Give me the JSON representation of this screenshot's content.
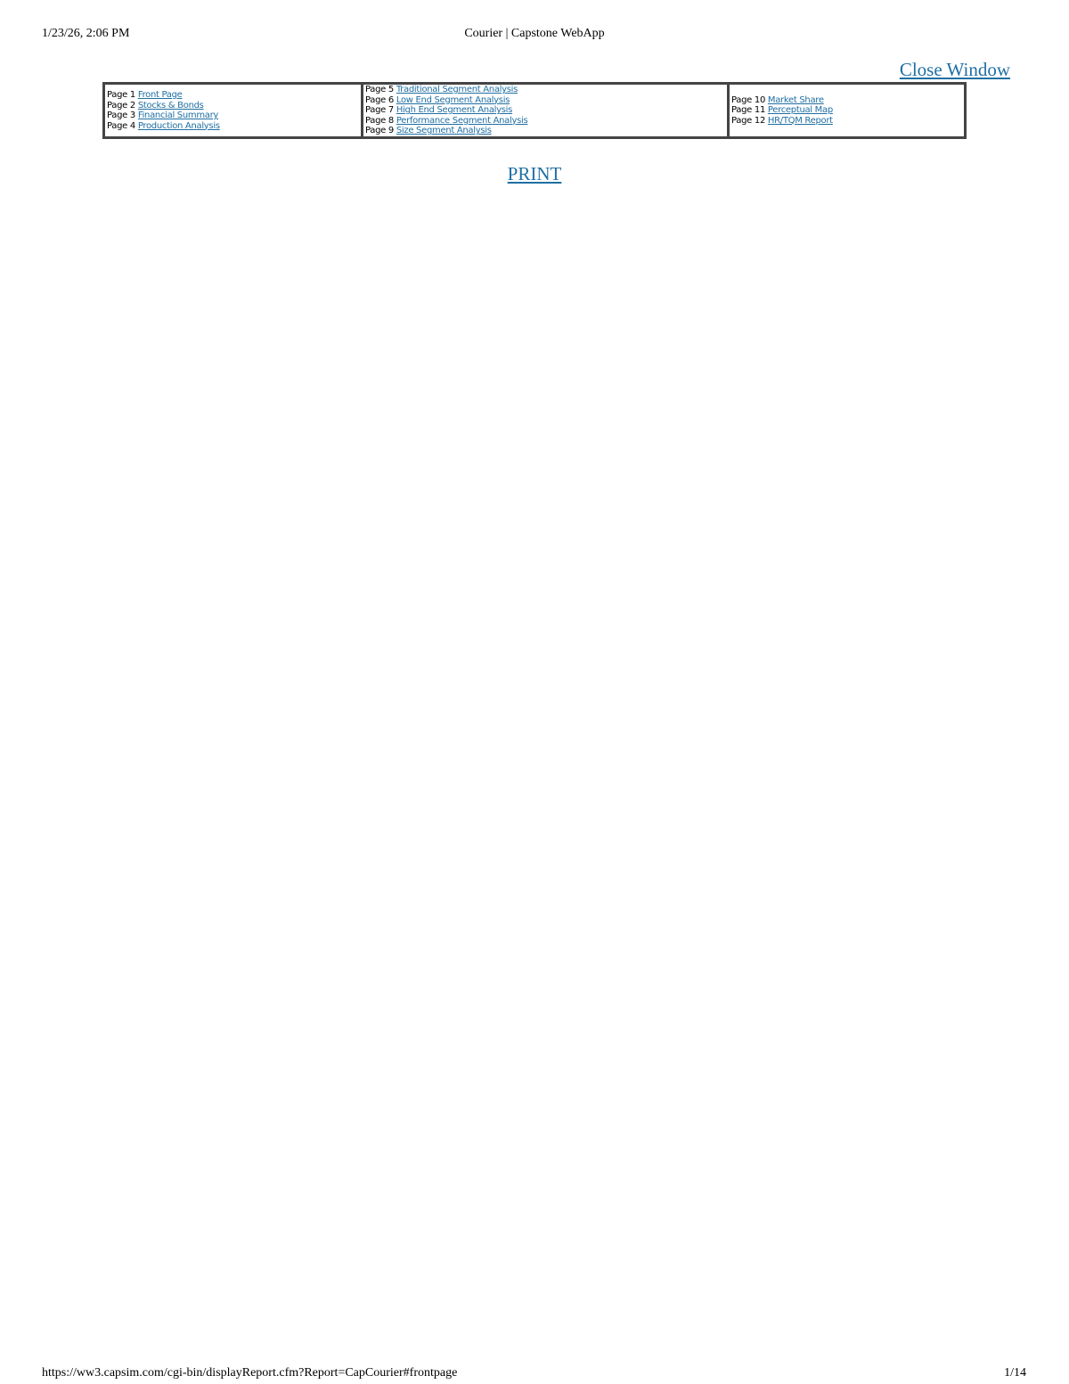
{
  "print_header": {
    "date": "1/23/26, 2:06 PM",
    "title": "Courier | Capstone WebApp"
  },
  "close_window_label": "Close Window",
  "nav": {
    "columns": [
      [
        {
          "page": "Page 1",
          "label": "Front Page"
        },
        {
          "page": "Page 2",
          "label": "Stocks & Bonds"
        },
        {
          "page": "Page 3",
          "label": "Financial Summary"
        },
        {
          "page": "Page 4",
          "label": "Production Analysis"
        }
      ],
      [
        {
          "page": "Page 5",
          "label": "Traditional Segment Analysis"
        },
        {
          "page": "Page 6",
          "label": "Low End Segment Analysis"
        },
        {
          "page": "Page 7",
          "label": "High End Segment Analysis"
        },
        {
          "page": "Page 8",
          "label": "Performance Segment Analysis"
        },
        {
          "page": "Page 9",
          "label": "Size Segment Analysis"
        }
      ],
      [
        {
          "page": "Page 10",
          "label": "Market Share"
        },
        {
          "page": "Page 11",
          "label": "Perceptual Map"
        },
        {
          "page": "Page 12",
          "label": "HR/TQM Report"
        }
      ]
    ]
  },
  "print_label": "PRINT",
  "print_footer": {
    "url": "https://ww3.capsim.com/cgi-bin/displayReport.cfm?Report=CapCourier#frontpage",
    "page": "1/14"
  }
}
